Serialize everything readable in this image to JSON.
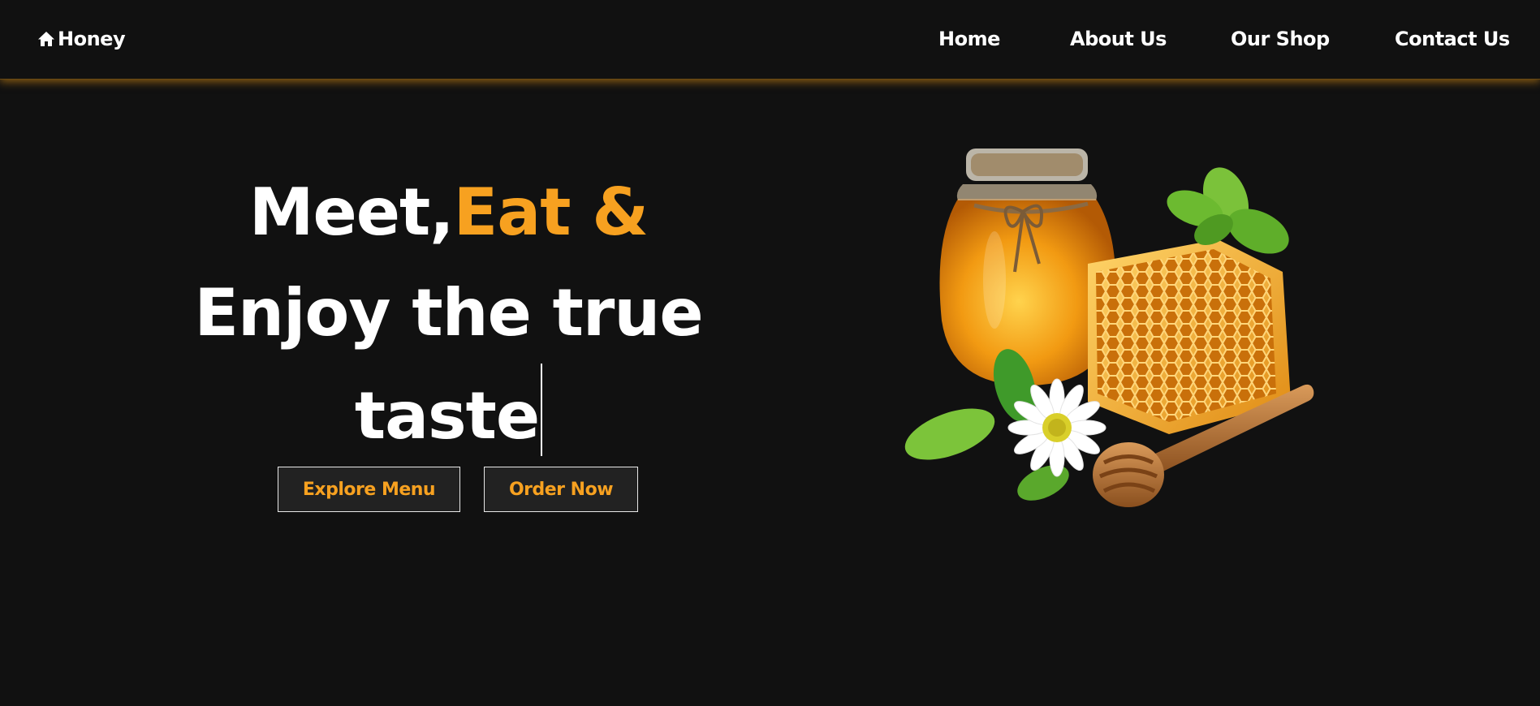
{
  "nav": {
    "brand": {
      "label": "Honey",
      "icon": "home-icon"
    },
    "links": [
      "Home",
      "About Us",
      "Our Shop",
      "Contact Us"
    ]
  },
  "hero": {
    "line1_white": "Meet,",
    "line1_accent": "Eat &",
    "line2": "Enjoy the true",
    "line3": "taste",
    "buttons": {
      "explore": "Explore Menu",
      "order": "Order Now"
    },
    "image": "honey-jar-honeycomb-dipper-daisy-illustration"
  },
  "colors": {
    "background": "#111111",
    "accent": "#f7a120",
    "text": "#ffffff",
    "button_bg": "#222222",
    "nav_glow": "#e69614"
  }
}
